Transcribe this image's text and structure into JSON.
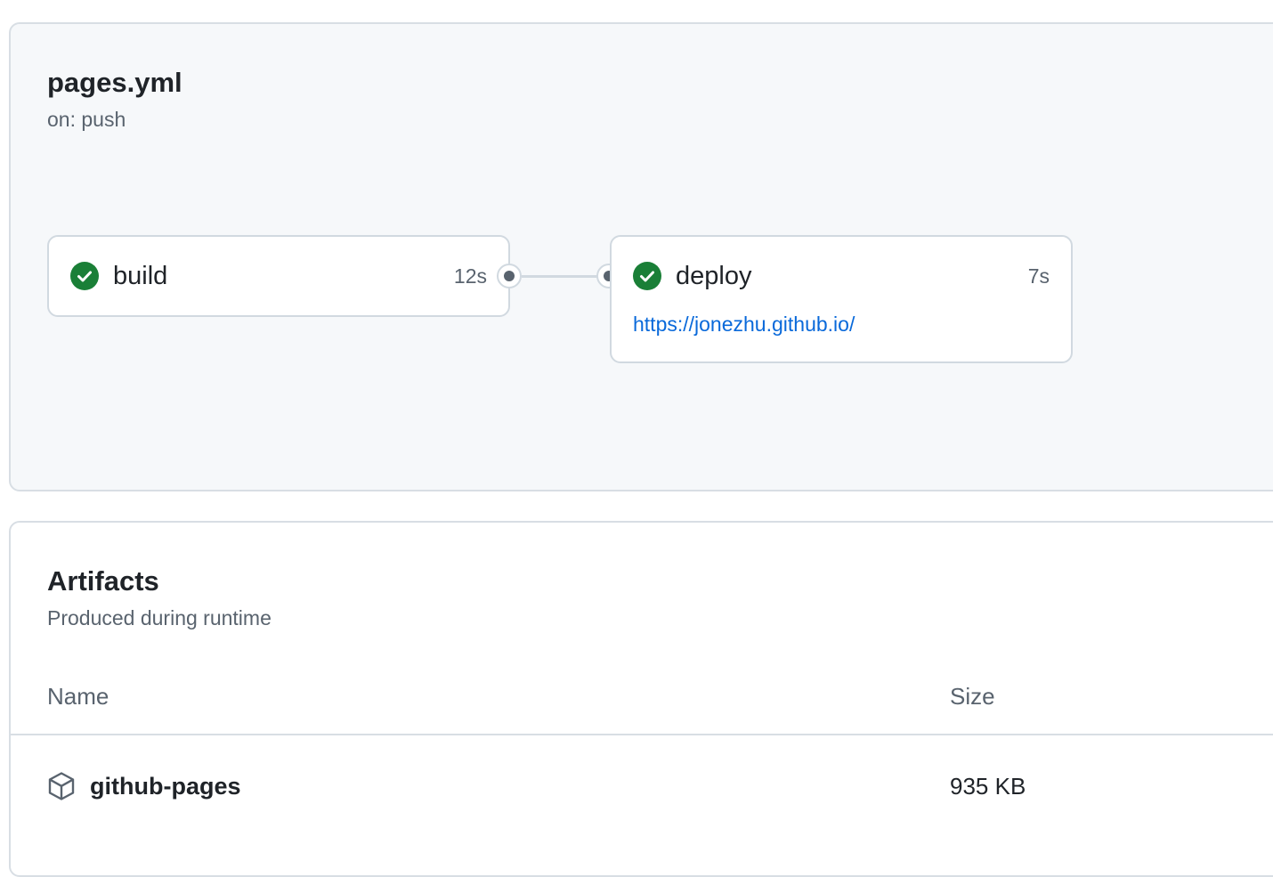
{
  "workflow": {
    "title": "pages.yml",
    "trigger": "on: push"
  },
  "jobs": [
    {
      "name": "build",
      "duration": "12s",
      "status": "success"
    },
    {
      "name": "deploy",
      "duration": "7s",
      "status": "success",
      "url": "https://jonezhu.github.io/"
    }
  ],
  "artifacts": {
    "title": "Artifacts",
    "subtitle": "Produced during runtime",
    "columns": {
      "name": "Name",
      "size": "Size"
    },
    "rows": [
      {
        "name": "github-pages",
        "size": "935 KB",
        "icon": "package-icon"
      }
    ]
  },
  "colors": {
    "success": "#1a7f37",
    "link": "#0969da",
    "panel_bg": "#f6f8fa",
    "muted_text": "#59636e"
  }
}
